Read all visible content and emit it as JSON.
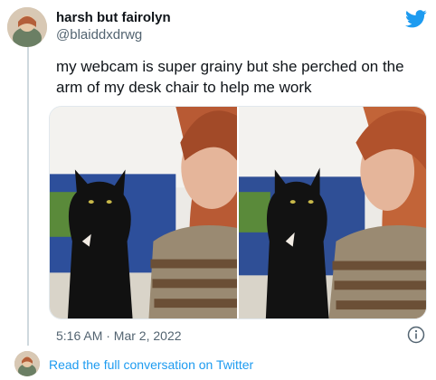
{
  "author": {
    "name": "harsh but fairolyn",
    "handle": "@blaiddxdrwg"
  },
  "tweet": {
    "text": "my webcam is super grainy but she perched on the arm of my desk chair to help me work",
    "timestamp": "5:16 AM · Mar 2, 2022"
  },
  "footer": {
    "link_label": "Read the full conversation on Twitter"
  },
  "icons": {
    "logo": "twitter-bird-icon",
    "info": "info-icon"
  },
  "colors": {
    "twitter_blue": "#1d9bf0",
    "text_primary": "#0f1419",
    "text_secondary": "#536471"
  }
}
